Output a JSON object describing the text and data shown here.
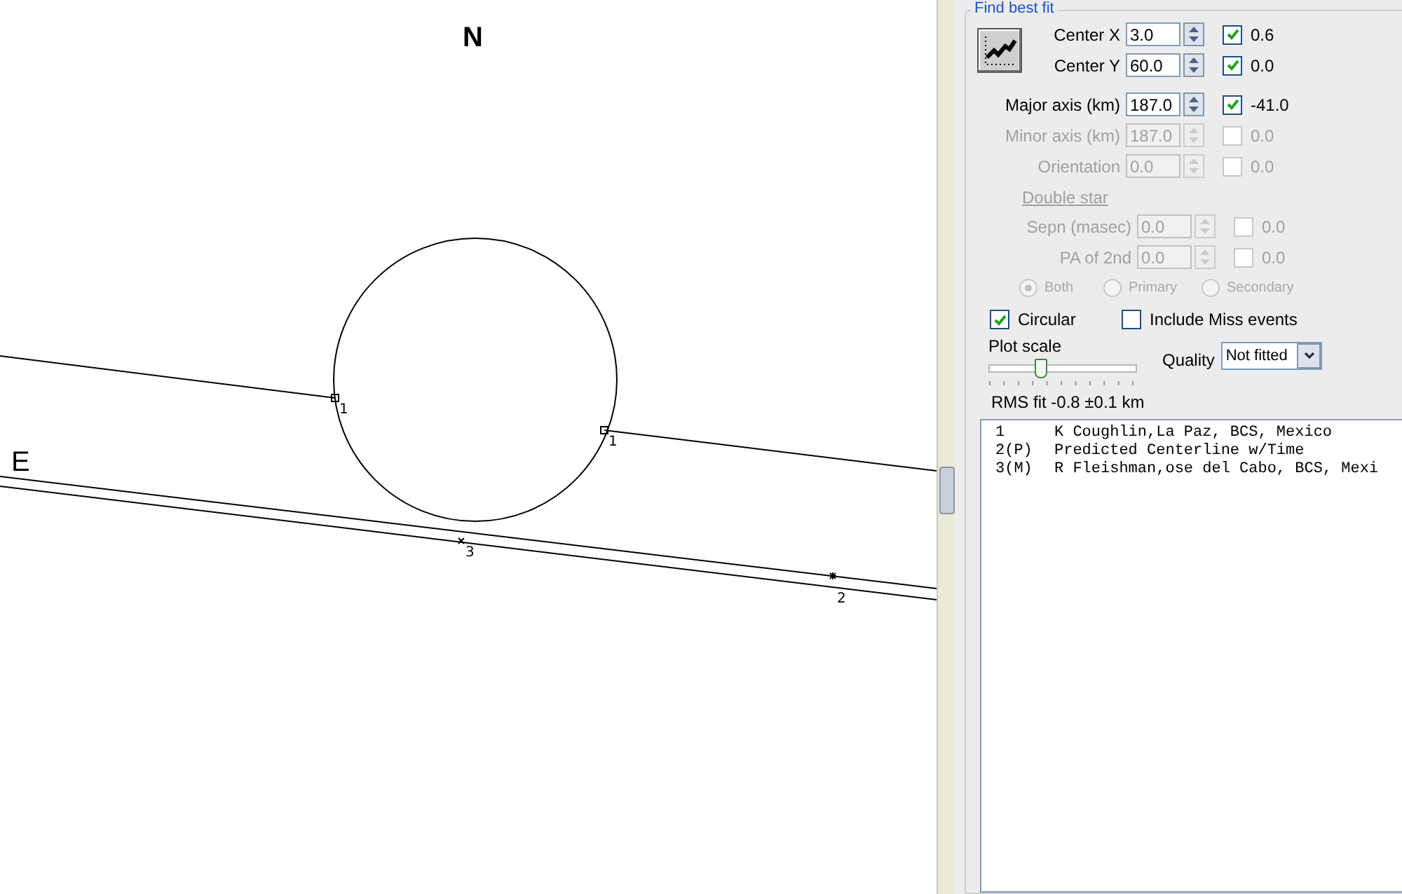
{
  "plot": {
    "north_label": "N",
    "east_label": "E",
    "chords": [
      {
        "label": "1",
        "kind": "square"
      },
      {
        "label": "1",
        "kind": "square"
      },
      {
        "label": "3",
        "kind": "cross"
      },
      {
        "label": "2",
        "kind": "star"
      }
    ]
  },
  "fit_panel": {
    "title": "Find best fit",
    "parameters": [
      {
        "label": "Center X",
        "value": "3.0",
        "disabled": false,
        "checked": true,
        "result": "0.6"
      },
      {
        "label": "Center Y",
        "value": "60.0",
        "disabled": false,
        "checked": true,
        "result": "0.0"
      },
      {
        "label": "Major axis (km)",
        "value": "187.0",
        "disabled": false,
        "checked": true,
        "result": "-41.0"
      },
      {
        "label": "Minor axis (km)",
        "value": "187.0",
        "disabled": true,
        "checked": false,
        "result": "0.0"
      },
      {
        "label": "Orientation",
        "value": "0.0",
        "disabled": true,
        "checked": false,
        "result": "0.0"
      }
    ],
    "double_star": {
      "title": "Double star",
      "disabled": true,
      "parameters": [
        {
          "label": "Sepn (masec)",
          "value": "0.0",
          "checked": false,
          "result": "0.0"
        },
        {
          "label": "PA of 2nd",
          "value": "0.0",
          "checked": false,
          "result": "0.0"
        }
      ],
      "modes": [
        {
          "label": "Both",
          "selected": true
        },
        {
          "label": "Primary",
          "selected": false
        },
        {
          "label": "Secondary",
          "selected": false
        }
      ]
    },
    "options": [
      {
        "label": "Circular",
        "checked": true
      },
      {
        "label": "Include Miss events",
        "checked": false
      }
    ],
    "plot_scale": {
      "label": "Plot scale",
      "level": 0.35
    },
    "quality": {
      "label": "Quality",
      "value": "Not fitted"
    },
    "rms_fit": "RMS fit -0.8 ±0.1 km",
    "observers": [
      {
        "index": "1",
        "name": "K Coughlin,La Paz, BCS, Mexico"
      },
      {
        "index": "2(P)",
        "name": "Predicted Centerline w/Time"
      },
      {
        "index": "3(M)",
        "name": "R Fleishman,ose del Cabo, BCS, Mexi"
      }
    ]
  }
}
